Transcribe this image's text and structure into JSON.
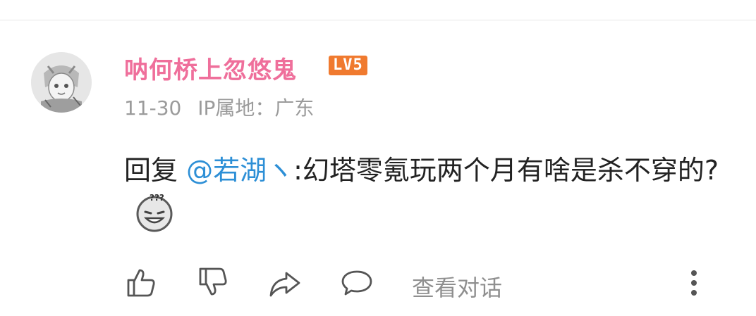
{
  "comment": {
    "username": "呐何桥上忽悠鬼",
    "level_badge": "LV5",
    "date": "11-30",
    "ip_location": "IP属地：广东",
    "reply_prefix": "回复 ",
    "mention": "@若湖ヽ",
    "text": ":幻塔零氪玩两个月有啥是杀不穿的?",
    "emoji": "confused-thinking-emoji"
  },
  "actions": {
    "view_conversation": "查看对话",
    "icons": [
      "thumbs-up-icon",
      "thumbs-down-icon",
      "share-icon",
      "comment-icon",
      "more-vertical-icon"
    ]
  },
  "colors": {
    "username": "#ef6f9b",
    "badge": "#f07a2f",
    "mention": "#2d8fd6",
    "meta": "#9b9b9b"
  }
}
